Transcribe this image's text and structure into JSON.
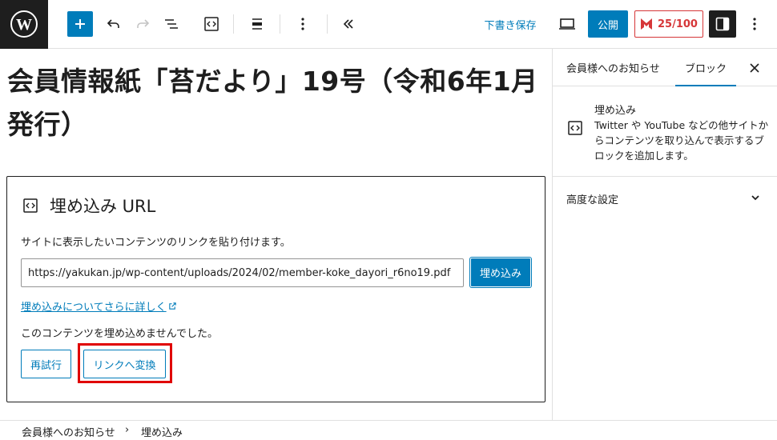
{
  "toolbar": {
    "draft_save": "下書き保存",
    "publish": "公開",
    "score": "25/100"
  },
  "post": {
    "title": "会員情報紙「苔だより」19号（令和6年1月発行）"
  },
  "embed": {
    "title": "埋め込み URL",
    "instructions": "サイトに表示したいコンテンツのリンクを貼り付けます。",
    "url_value": "https://yakukan.jp/wp-content/uploads/2024/02/member-koke_dayori_r6no19.pdf",
    "embed_button": "埋め込み",
    "learn_more": "埋め込みについてさらに詳しく",
    "error": "このコンテンツを埋め込めませんでした。",
    "retry": "再試行",
    "convert_to_link": "リンクへ変換"
  },
  "sidebar": {
    "tab_document": "会員様へのお知らせ",
    "tab_block": "ブロック",
    "block_title": "埋め込み",
    "block_description": "Twitter や YouTube などの他サイトからコンテンツを取り込んで表示するブロックを追加します。",
    "advanced": "高度な設定"
  },
  "breadcrumb": {
    "items": [
      "会員様へのお知らせ",
      "埋め込み"
    ],
    "separator": "›"
  },
  "colors": {
    "accent": "#007cba",
    "highlight": "#e00000",
    "score": "#d63638"
  }
}
